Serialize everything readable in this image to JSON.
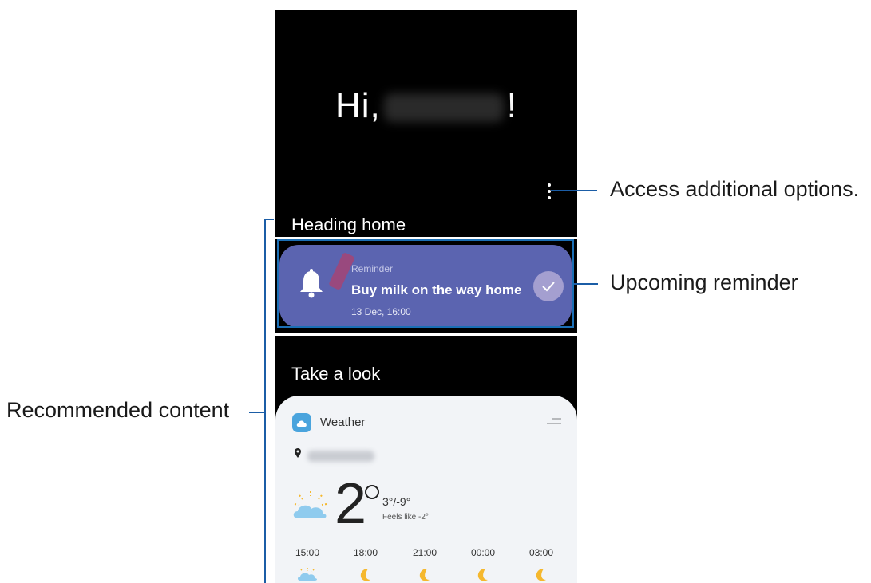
{
  "greeting": {
    "prefix": "Hi,",
    "suffix": "!"
  },
  "sections": {
    "heading_home": "Heading home",
    "take_a_look": "Take a look"
  },
  "reminder": {
    "label": "Reminder",
    "title": "Buy milk on the way home",
    "time": "13 Dec, 16:00"
  },
  "weather": {
    "title": "Weather",
    "temperature": "2",
    "hi_lo": "3°/-9°",
    "feels_like": "Feels like -2°",
    "hours": [
      {
        "time": "15:00",
        "icon": "sun-cloud-icon"
      },
      {
        "time": "18:00",
        "icon": "moon-icon"
      },
      {
        "time": "21:00",
        "icon": "moon-icon"
      },
      {
        "time": "00:00",
        "icon": "moon-icon"
      },
      {
        "time": "03:00",
        "icon": "moon-icon"
      }
    ]
  },
  "callouts": {
    "options": "Access additional options.",
    "reminder": "Upcoming reminder",
    "recommended": "Recommended content"
  },
  "colors": {
    "reminder_bg": "#5b64b0",
    "callout_line": "#1b5da6",
    "weather_accent": "#4aa4dd",
    "moon": "#f5b82e"
  }
}
